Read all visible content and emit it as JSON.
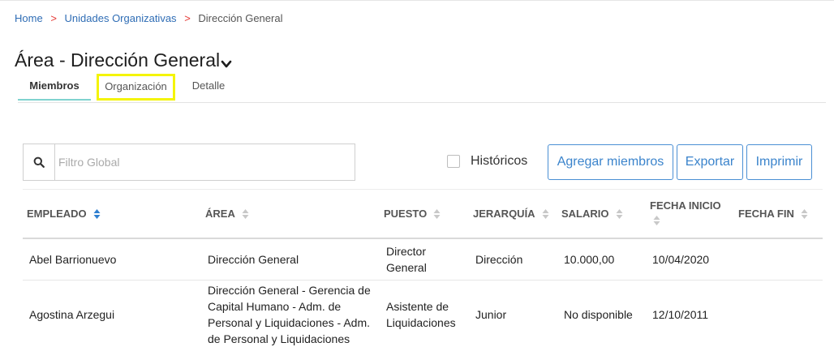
{
  "breadcrumb": {
    "items": [
      "Home",
      "Unidades Organizativas"
    ],
    "separator": ">",
    "current": "Dirección General"
  },
  "page": {
    "title": "Área - Dirección General"
  },
  "tabs": [
    {
      "label": "Miembros",
      "active": true
    },
    {
      "label": "Organización",
      "highlighted": true
    },
    {
      "label": "Detalle"
    }
  ],
  "search": {
    "placeholder": "Filtro Global",
    "value": ""
  },
  "historicos": {
    "label": "Históricos",
    "checked": false
  },
  "actions": {
    "add_members": "Agregar miembros",
    "export": "Exportar",
    "print": "Imprimir"
  },
  "table": {
    "columns": [
      "EMPLEADO",
      "ÁREA",
      "PUESTO",
      "JERARQUÍA",
      "SALARIO",
      "FECHA INICIO",
      "FECHA FIN"
    ],
    "sorted_column": "EMPLEADO",
    "rows": [
      {
        "empleado": "Abel Barrionuevo",
        "area": "Dirección General",
        "puesto": "Director General",
        "jerarquia": "Dirección",
        "salario": "10.000,00",
        "fecha_inicio": "10/04/2020",
        "fecha_fin": ""
      },
      {
        "empleado": "Agostina Arzegui",
        "area": "Dirección General - Gerencia de Capital Humano - Adm. de Personal y Liquidaciones - Adm. de Personal y Liquidaciones",
        "puesto": "Asistente de Liquidaciones",
        "jerarquia": "Junior",
        "salario": "No disponible",
        "fecha_inicio": "12/10/2011",
        "fecha_fin": ""
      }
    ]
  },
  "colors": {
    "link": "#2f6db5",
    "separator": "#e53935",
    "button": "#3b84cc",
    "active_tab": "#7fd3cf",
    "highlight": "#f4f407",
    "sort_active": "#2f7fd0",
    "sort_inactive": "#c8c8c8"
  },
  "icons": {
    "search": "search-icon",
    "title_dropdown": "chevron-down-icon",
    "sort": "sort-icon"
  }
}
